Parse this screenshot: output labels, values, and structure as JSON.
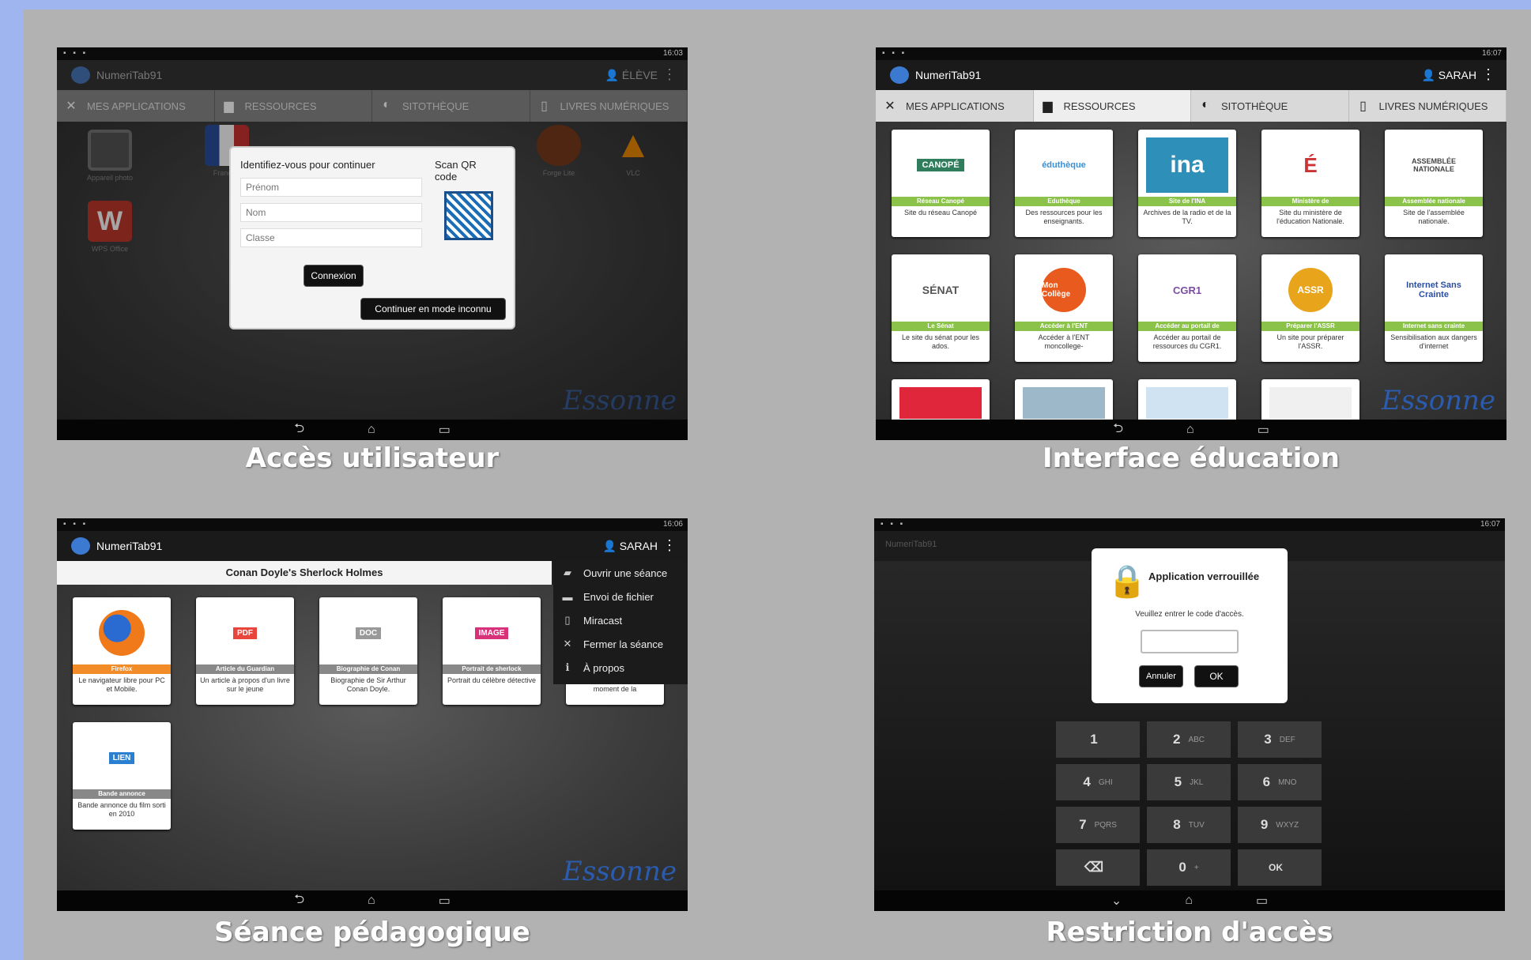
{
  "panels": {
    "acces": {
      "caption": "Accès utilisateur",
      "app_title": "NumeriTab91",
      "user": "ÉLÈVE",
      "status_time": "16:03",
      "tabs": [
        "MES APPLICATIONS",
        "RESSOURCES",
        "SITOTHÈQUE",
        "LIVRES NUMÉRIQUES"
      ],
      "apps": [
        "Appareil photo",
        "Français",
        "Forge Lite",
        "VLC",
        "WPS Office"
      ],
      "dialog": {
        "prompt": "Identifiez-vous pour continuer",
        "scan": "Scan QR code",
        "first_name_placeholder": "Prénom",
        "last_name_placeholder": "Nom",
        "class_placeholder": "Classe",
        "login": "Connexion",
        "anonymous": "Continuer en mode inconnu"
      },
      "signature": "Essonne"
    },
    "education": {
      "caption": "Interface éducation",
      "app_title": "NumeriTab91",
      "user": "SARAH",
      "status_time": "16:07",
      "tabs": [
        "MES APPLICATIONS",
        "RESSOURCES",
        "SITOTHÈQUE",
        "LIVRES NUMÉRIQUES"
      ],
      "cards": [
        {
          "logo": "CANOPÉ",
          "band": "Réseau Canopé",
          "desc": "Site du réseau Canopé"
        },
        {
          "logo": "éduthèque",
          "band": "Eduthèque",
          "desc": "Des ressources pour les enseignants."
        },
        {
          "logo": "ina",
          "band": "Site de l'INA",
          "desc": "Archives de la radio et de la TV."
        },
        {
          "logo": "É",
          "band": "Ministère de",
          "desc": "Site du ministère de l'éducation Nationale."
        },
        {
          "logo": "ASSEMBLÉE NATIONALE",
          "band": "Assemblée nationale",
          "desc": "Site de l'assemblée nationale."
        },
        {
          "logo": "SÉNAT",
          "band": "Le Sénat",
          "desc": "Le site du sénat pour les ados."
        },
        {
          "logo": "Mon Collège",
          "band": "Accéder à l'ENT",
          "desc": "Accéder à l'ENT moncollege-"
        },
        {
          "logo": "CGR1",
          "band": "Accéder au portail de",
          "desc": "Accéder au portail de ressources du CGR1."
        },
        {
          "logo": "ASSR",
          "band": "Préparer l'ASSR",
          "desc": "Un site pour préparer l'ASSR."
        },
        {
          "logo": "Internet Sans Crainte",
          "band": "Internet sans crainte",
          "desc": "Sensibilisation aux dangers d'internet"
        }
      ],
      "signature": "Essonne"
    },
    "seance": {
      "caption": "Séance pédagogique",
      "app_title": "NumeriTab91",
      "user": "SARAH",
      "status_time": "16:06",
      "session_title": "Conan Doyle's Sherlock Holmes",
      "menu": [
        "Ouvrir une séance",
        "Envoi de fichier",
        "Miracast",
        "Fermer la séance",
        "À propos"
      ],
      "cards": [
        {
          "badge": "",
          "band": "Firefox",
          "desc": "Le navigateur libre pour PC et Mobile."
        },
        {
          "badge": "PDF",
          "band": "Article du Guardian",
          "desc": "Un article à propos d'un livre sur le jeune"
        },
        {
          "badge": "DOC",
          "band": "Biographie de Conan",
          "desc": "Biographie de Sir Arthur Conan Doyle."
        },
        {
          "badge": "IMAGE",
          "band": "Portrait de sherlock",
          "desc": "Portrait du célèbre détective"
        },
        {
          "badge": "",
          "band": "",
          "desc": "Livre audio représentant le moment de la"
        },
        {
          "badge": "LIEN",
          "band": "Bande annonce",
          "desc": "Bande annonce du film sorti en 2010"
        }
      ],
      "signature": "Essonne"
    },
    "restriction": {
      "caption": "Restriction d'accès",
      "app_title": "NumeriTab91",
      "status_time": "16:07",
      "dialog_title": "Application verrouillée",
      "dialog_sub": "Veuillez entrer le code d'accès.",
      "cancel": "Annuler",
      "ok": "OK",
      "keys": [
        {
          "n": "1",
          "l": ""
        },
        {
          "n": "2",
          "l": "ABC"
        },
        {
          "n": "3",
          "l": "DEF"
        },
        {
          "n": "4",
          "l": "GHI"
        },
        {
          "n": "5",
          "l": "JKL"
        },
        {
          "n": "6",
          "l": "MNO"
        },
        {
          "n": "7",
          "l": "PQRS"
        },
        {
          "n": "8",
          "l": "TUV"
        },
        {
          "n": "9",
          "l": "WXYZ"
        },
        {
          "n": "⌫",
          "l": ""
        },
        {
          "n": "0",
          "l": "+"
        },
        {
          "n": "OK",
          "l": ""
        }
      ]
    }
  }
}
